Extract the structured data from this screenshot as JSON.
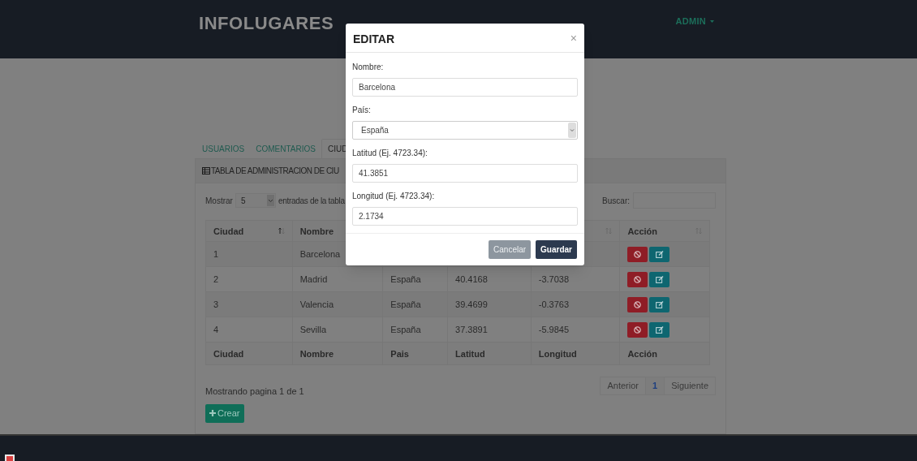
{
  "navbar": {
    "brand": "INFOLUGARES",
    "user_menu": {
      "label": "ADMIN"
    }
  },
  "tabs": [
    {
      "label": "USUARIOS",
      "selected": false
    },
    {
      "label": "COMENTARIOS",
      "selected": false
    },
    {
      "label": "CIUD",
      "selected": true
    }
  ],
  "panel": {
    "title": "TABLA DE ADMINISTRACION DE CIU"
  },
  "length_control": {
    "label": "Mostrar",
    "value": "5",
    "suffix": "entradas de la tabla"
  },
  "search": {
    "label": "Buscar:"
  },
  "table": {
    "header_left": [
      {
        "label": "Ciudad",
        "sorted": true
      },
      {
        "label": "Nombre"
      }
    ],
    "header_last": {
      "label": "Acción"
    },
    "rows": [
      {
        "cells": [
          "1",
          "Barcelona"
        ]
      },
      {
        "cells": [
          "2",
          "Madrid",
          "España",
          "40.4168",
          "-3.7038"
        ]
      },
      {
        "cells": [
          "3",
          "Valencia",
          "España",
          "39.4699",
          "-0.3763"
        ]
      },
      {
        "cells": [
          "4",
          "Sevilla",
          "España",
          "37.3891",
          "-5.9845"
        ]
      }
    ],
    "footer": [
      "Ciudad",
      "Nombre",
      "Pais",
      "Latitud",
      "Longitud",
      "Acción"
    ]
  },
  "info": "Mostrando pagina 1 de 1",
  "pagination": [
    {
      "label": "Anterior",
      "selected": false,
      "disabled": true
    },
    {
      "label": "1",
      "selected": true,
      "disabled": false
    },
    {
      "label": "Siguiente",
      "selected": false,
      "disabled": true
    }
  ],
  "create_button": {
    "label": "Crear"
  },
  "modal": {
    "title": "EDITAR",
    "close": "×",
    "fields": [
      {
        "label": "Nombre:",
        "kind": "text",
        "value": "Barcelona"
      },
      {
        "label": "País:",
        "kind": "select",
        "value": "España"
      },
      {
        "label": "Latitud (Ej. 4723.34):",
        "kind": "text",
        "value": "41.3851"
      },
      {
        "label": "Longitud (Ej. 4723.34):",
        "kind": "text",
        "value": "2.1734"
      }
    ],
    "buttons": [
      {
        "label": "Cancelar",
        "kind": "secondary"
      },
      {
        "label": "Guardar",
        "kind": "primary"
      }
    ]
  }
}
